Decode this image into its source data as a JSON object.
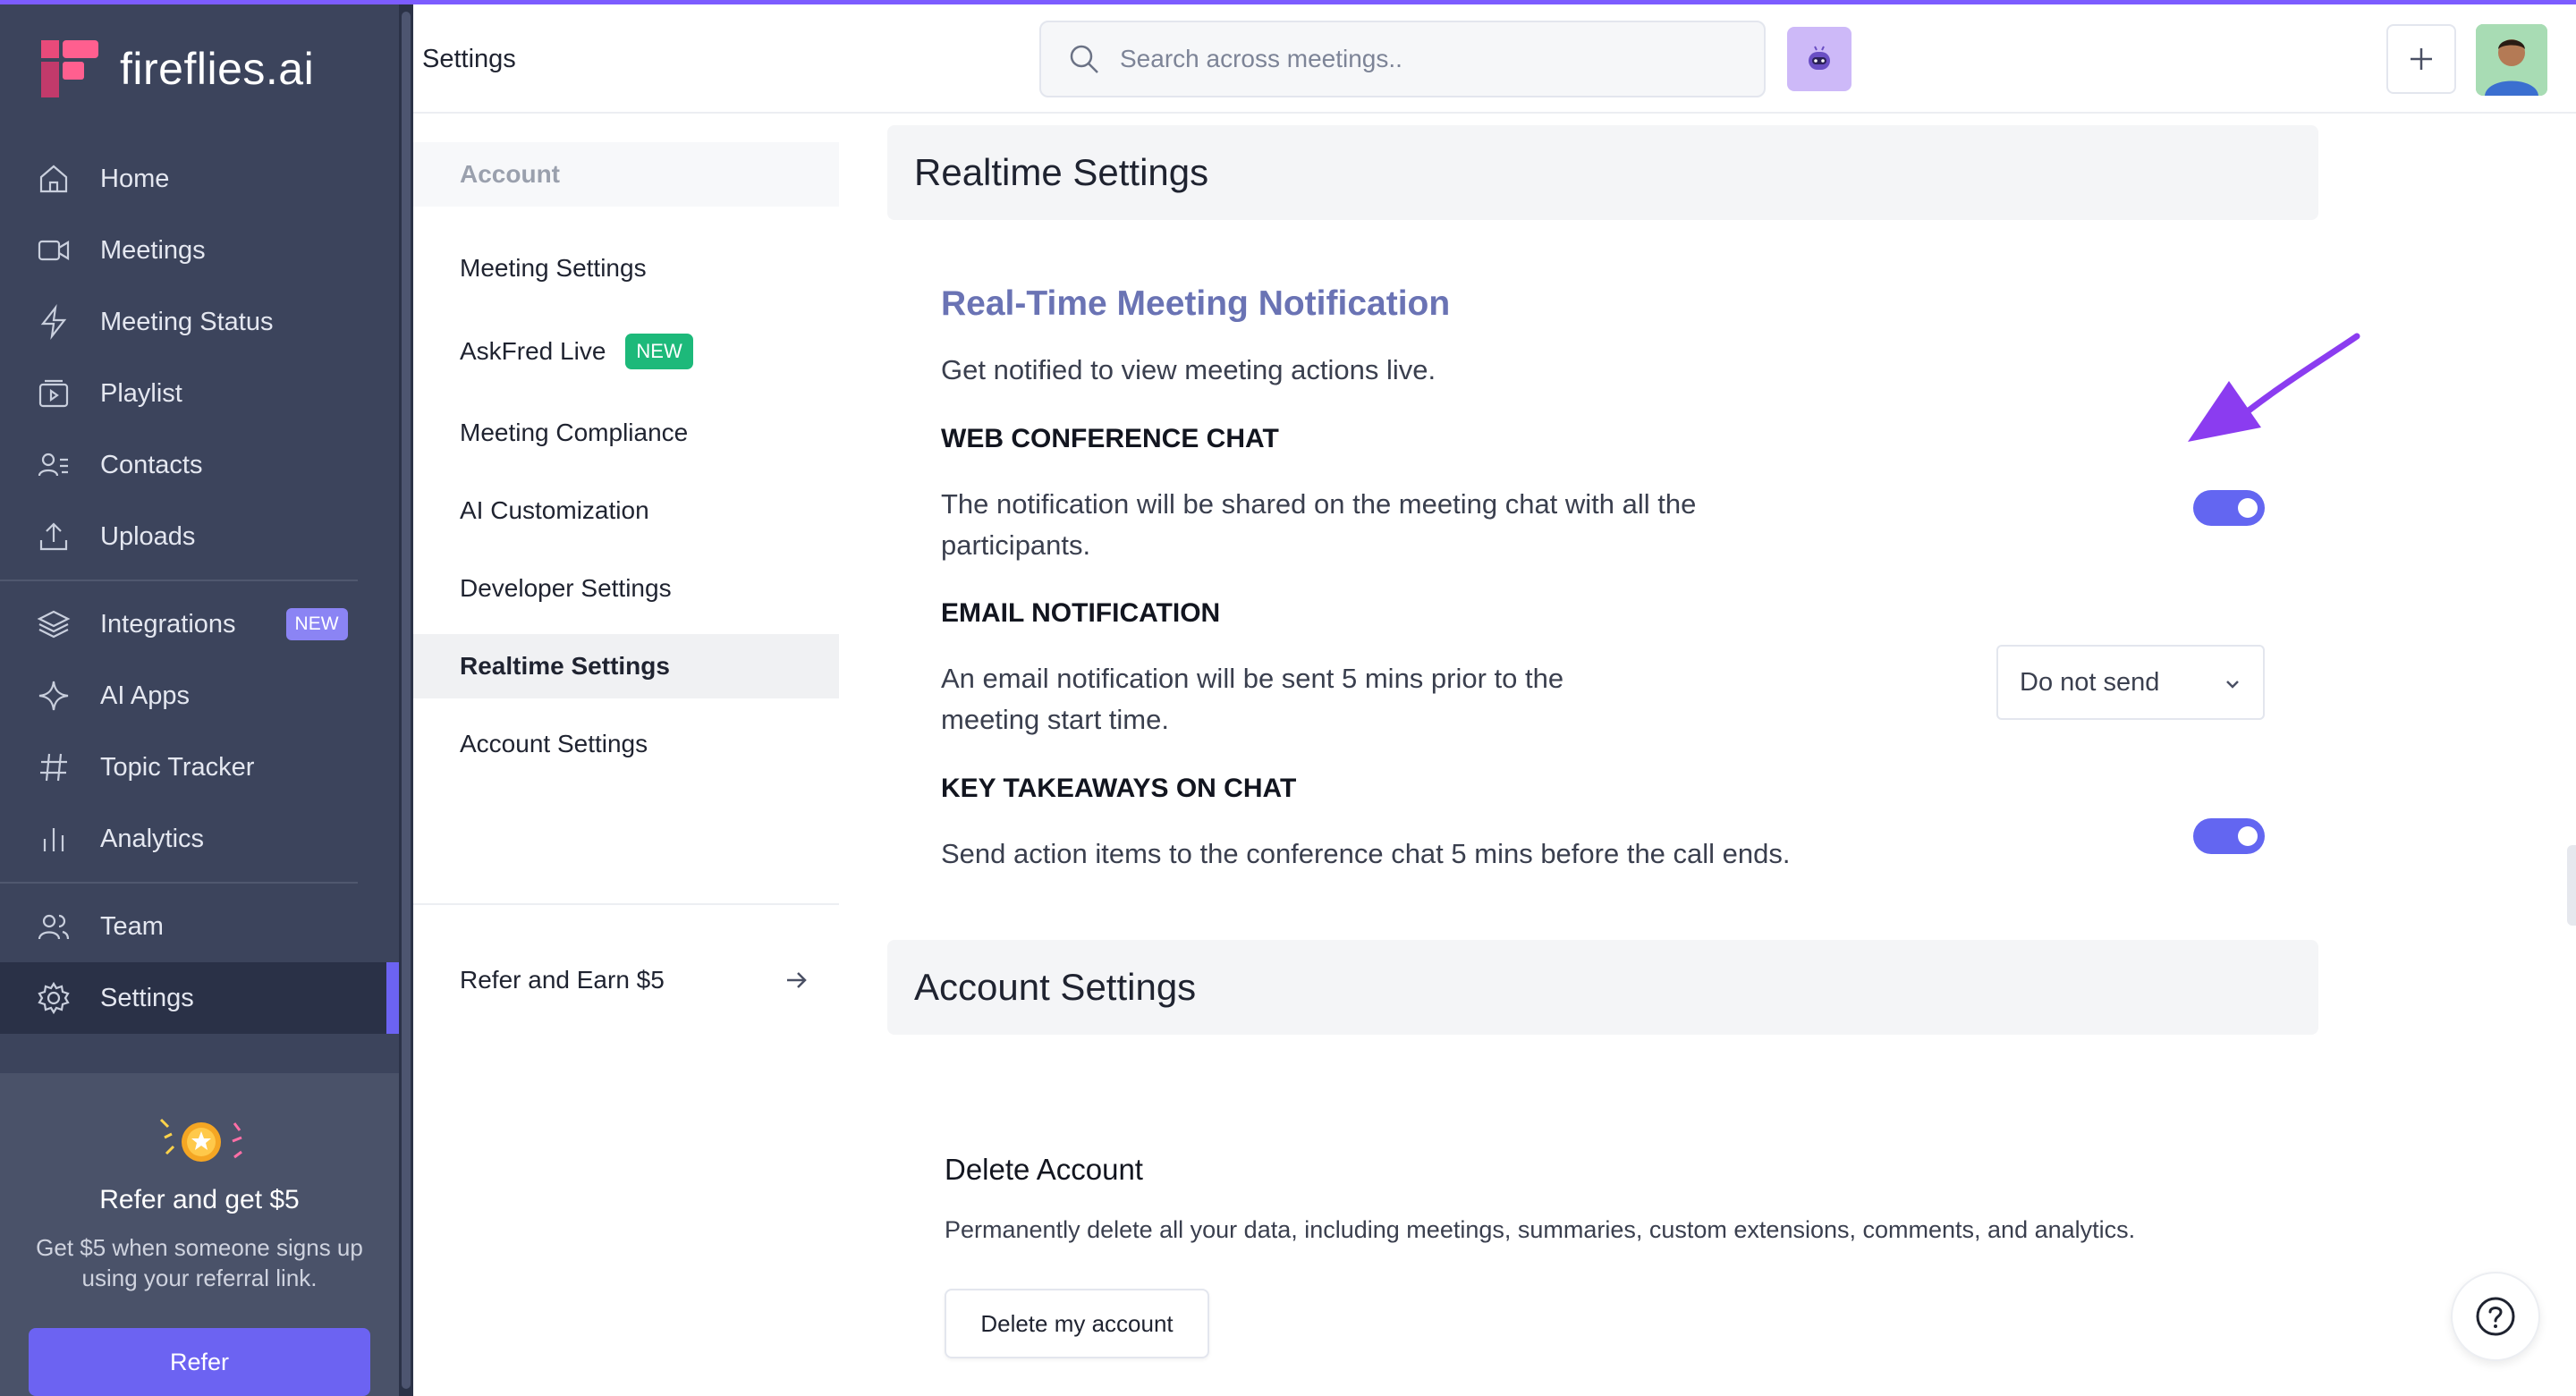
{
  "app": {
    "name": "fireflies.ai",
    "accent": "#6c63f2"
  },
  "sidebar": {
    "items": [
      {
        "label": "Home",
        "icon": "home-icon"
      },
      {
        "label": "Meetings",
        "icon": "video-icon"
      },
      {
        "label": "Meeting Status",
        "icon": "bolt-icon"
      },
      {
        "label": "Playlist",
        "icon": "playlist-icon"
      },
      {
        "label": "Contacts",
        "icon": "contacts-icon"
      },
      {
        "label": "Uploads",
        "icon": "upload-icon"
      },
      {
        "label": "Integrations",
        "icon": "layers-icon",
        "badge": "NEW"
      },
      {
        "label": "AI Apps",
        "icon": "sparkle-icon"
      },
      {
        "label": "Topic Tracker",
        "icon": "hash-icon"
      },
      {
        "label": "Analytics",
        "icon": "bar-chart-icon"
      },
      {
        "label": "Team",
        "icon": "team-icon"
      },
      {
        "label": "Settings",
        "icon": "gear-icon"
      }
    ],
    "refer": {
      "title": "Refer and get $5",
      "description": "Get $5 when someone signs up using your referral link.",
      "button": "Refer"
    }
  },
  "header": {
    "title": "Settings",
    "search_placeholder": "Search across meetings.."
  },
  "subnav": {
    "section": "Account",
    "items": [
      {
        "label": "Meeting Settings"
      },
      {
        "label": "AskFred Live",
        "badge": "NEW"
      },
      {
        "label": "Meeting Compliance"
      },
      {
        "label": "AI Customization"
      },
      {
        "label": "Developer Settings"
      },
      {
        "label": "Realtime Settings"
      },
      {
        "label": "Account Settings"
      }
    ],
    "refer_earn": "Refer and Earn $5"
  },
  "realtime": {
    "heading": "Realtime Settings",
    "title": "Real-Time Meeting Notification",
    "description": "Get notified to view meeting actions live.",
    "web_chat": {
      "title": "WEB CONFERENCE CHAT",
      "description": "The notification will be shared on the meeting chat with all the participants.",
      "enabled": true
    },
    "email": {
      "title": "EMAIL NOTIFICATION",
      "description": "An email notification will be sent 5 mins prior to the meeting start time.",
      "selected": "Do not send"
    },
    "takeaways": {
      "title": "KEY TAKEAWAYS ON CHAT",
      "description": "Send action items to the conference chat 5 mins before the call ends.",
      "enabled": true
    }
  },
  "account": {
    "heading": "Account Settings",
    "delete_title": "Delete Account",
    "delete_description": "Permanently delete all your data, including meetings, summaries, custom extensions, comments, and analytics.",
    "delete_button": "Delete my account"
  }
}
